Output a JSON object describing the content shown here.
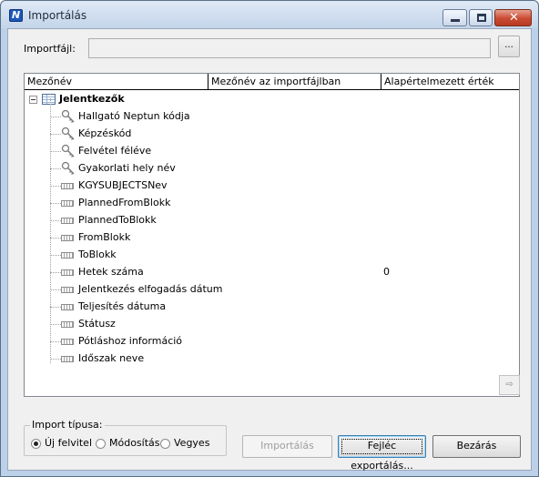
{
  "window": {
    "title": "Importálás",
    "icon_glyph": "N",
    "close_glyph": "✕"
  },
  "file": {
    "label": "Importfájl:",
    "value": "",
    "browse_label": "..."
  },
  "tree": {
    "columns": [
      "Mezőnév",
      "Mezőnév az importfájlban",
      "Alapértelmezett érték"
    ],
    "root": {
      "label": "Jelentkezők",
      "icon": "table-icon",
      "expanded": true
    },
    "fields": [
      {
        "name": "Hallgató Neptun kódja",
        "icon": "key-icon",
        "default": ""
      },
      {
        "name": "Képzéskód",
        "icon": "key-icon",
        "default": ""
      },
      {
        "name": "Felvétel féléve",
        "icon": "key-icon",
        "default": ""
      },
      {
        "name": "Gyakorlati hely név",
        "icon": "key-icon",
        "default": ""
      },
      {
        "name": "KGYSUBJECTSNev",
        "icon": "field-icon",
        "default": ""
      },
      {
        "name": "PlannedFromBlokk",
        "icon": "field-icon",
        "default": ""
      },
      {
        "name": "PlannedToBlokk",
        "icon": "field-icon",
        "default": ""
      },
      {
        "name": "FromBlokk",
        "icon": "field-icon",
        "default": ""
      },
      {
        "name": "ToBlokk",
        "icon": "field-icon",
        "default": ""
      },
      {
        "name": "Hetek száma",
        "icon": "field-icon",
        "default": "0"
      },
      {
        "name": "Jelentkezés elfogadás dátum",
        "icon": "field-icon",
        "default": ""
      },
      {
        "name": "Teljesítés dátuma",
        "icon": "field-icon",
        "default": ""
      },
      {
        "name": "Státusz",
        "icon": "field-icon",
        "default": ""
      },
      {
        "name": "Pótláshoz információ",
        "icon": "field-icon",
        "default": ""
      },
      {
        "name": "Időszak neve",
        "icon": "field-icon",
        "default": ""
      }
    ],
    "scroll_button_glyph": "⇨"
  },
  "import_type": {
    "label": "Import típusa:",
    "options": [
      "Új felvitel",
      "Módosítás",
      "Vegyes"
    ],
    "selected": "Új felvitel"
  },
  "buttons": {
    "import": "Importálás",
    "export_header": "Fejléc exportálás...",
    "close": "Bezárás"
  }
}
